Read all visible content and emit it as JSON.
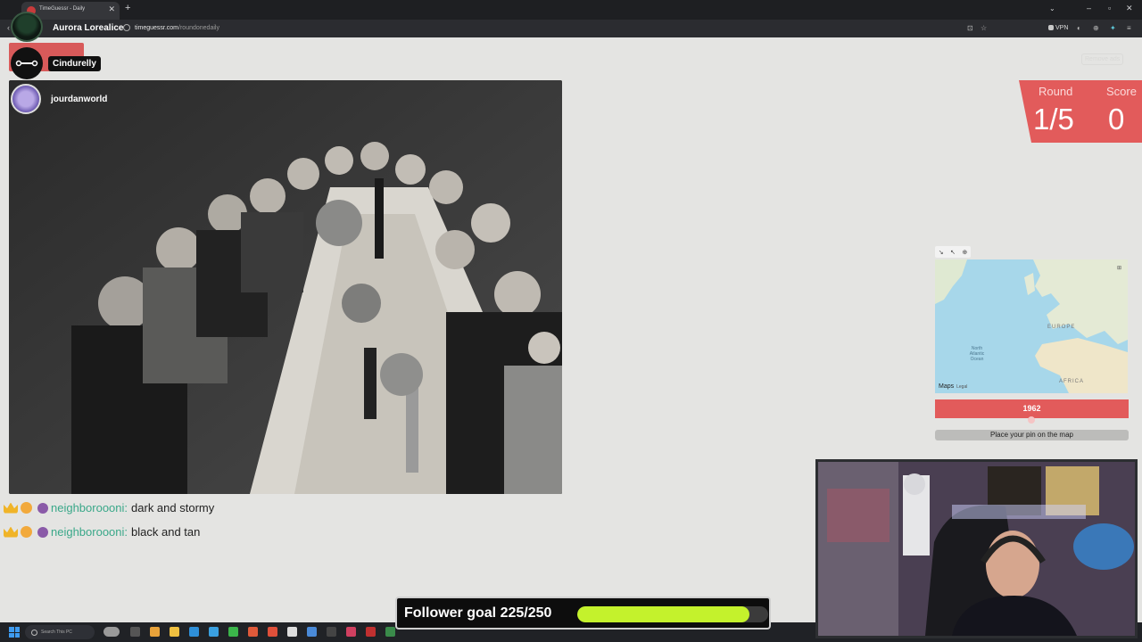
{
  "browser": {
    "tab_title": "TimeGuessr - Daily",
    "url_host": "timeguessr.com",
    "url_path": "/roundonedaily",
    "vpn_label": "VPN"
  },
  "streamer": {
    "name": "Aurora Lorealice"
  },
  "overlay_users": [
    {
      "name": "Cindurelly"
    },
    {
      "name": "jourdanworld"
    }
  ],
  "game": {
    "remove_label": "Remove ads",
    "round_label": "Round",
    "score_label": "Score",
    "round_value": "1/5",
    "score_value": "0",
    "year_value": "1962",
    "year_slider_fraction": 0.5,
    "place_pin_label": "Place your pin on the map",
    "map": {
      "labels": [
        "North Atlantic Ocean",
        "EUROPE",
        "AFRICA"
      ],
      "attribution": "Maps",
      "legal": "Legal"
    }
  },
  "chat": [
    {
      "user": "neighboroooni:",
      "message": "dark and stormy"
    },
    {
      "user": "neighboroooni:",
      "message": "black and tan"
    }
  ],
  "follower_goal": {
    "label": "Follower goal 225/250",
    "current": 225,
    "target": 250
  },
  "taskbar": {
    "search_placeholder": "Search This PC"
  },
  "colors": {
    "accent": "#e25b5b",
    "goal_fill": "#c4f22c",
    "chat_user": "#3aa889"
  }
}
